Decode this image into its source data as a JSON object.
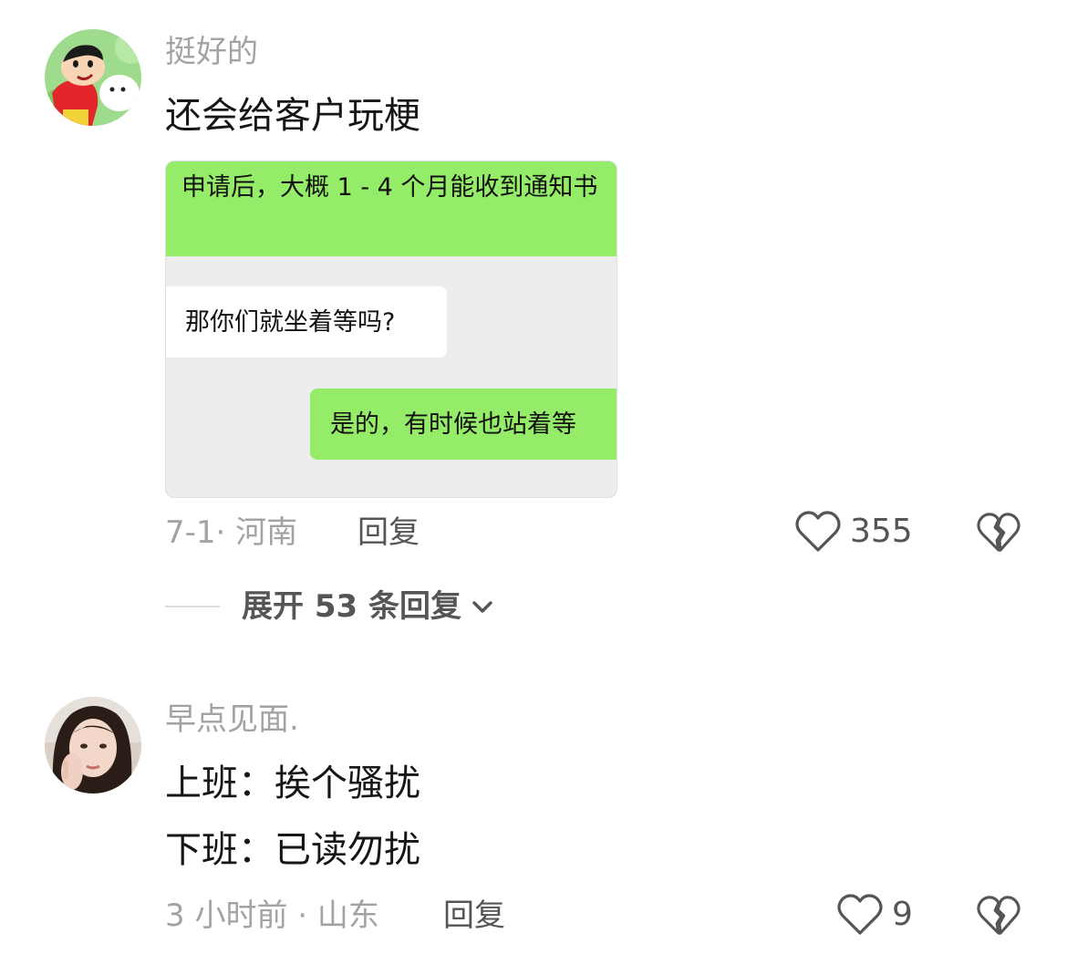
{
  "comments": [
    {
      "username": "挺好的",
      "avatar_icon": "crayon-shinchan-avatar",
      "text": "还会给客户玩梗",
      "attached_image": {
        "top_message": "申请后，大概 1 - 4 个月能收到通知书",
        "left_message": "那你们就坐着等吗?",
        "right_message": "是的，有时候也站着等"
      },
      "meta": "7-1· 河南",
      "reply_label": "回复",
      "like_count": "355",
      "expand_replies": "展开 53 条回复"
    },
    {
      "username": "早点见面.",
      "avatar_icon": "girl-photo-avatar",
      "text_lines": [
        "上班：挨个骚扰",
        "下班：已读勿扰"
      ],
      "meta": "3 小时前 · 山东",
      "reply_label": "回复",
      "like_count": "9"
    }
  ],
  "colors": {
    "chat_green": "#95ec69",
    "chat_bg": "#ededed",
    "muted_text": "#a3a3a3"
  }
}
